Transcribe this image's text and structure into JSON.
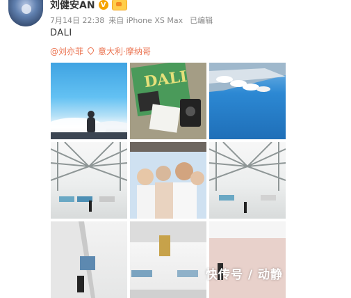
{
  "post": {
    "username": "刘健安AN",
    "verified_badge": "V",
    "date": "7月14日 22:38",
    "source": "来自 iPhone XS Max",
    "edited": "已编辑",
    "text": "DALI",
    "mention": "@刘亦菲",
    "location": "意大利·摩纳哥"
  },
  "images": [
    {
      "name": "image-sky-figure"
    },
    {
      "name": "image-dali-magazine"
    },
    {
      "name": "image-yachts-sea"
    },
    {
      "name": "image-gallery-hall-1"
    },
    {
      "name": "image-group-selfie"
    },
    {
      "name": "image-gallery-hall-2"
    },
    {
      "name": "image-exhibit-wall"
    },
    {
      "name": "image-exhibit-room"
    },
    {
      "name": "image-pink-room"
    }
  ],
  "magazine": {
    "title": "DALI"
  },
  "watermark": "快传号 / 动静",
  "colors": {
    "accent": "#eb7350",
    "badge": "#f6a400"
  }
}
